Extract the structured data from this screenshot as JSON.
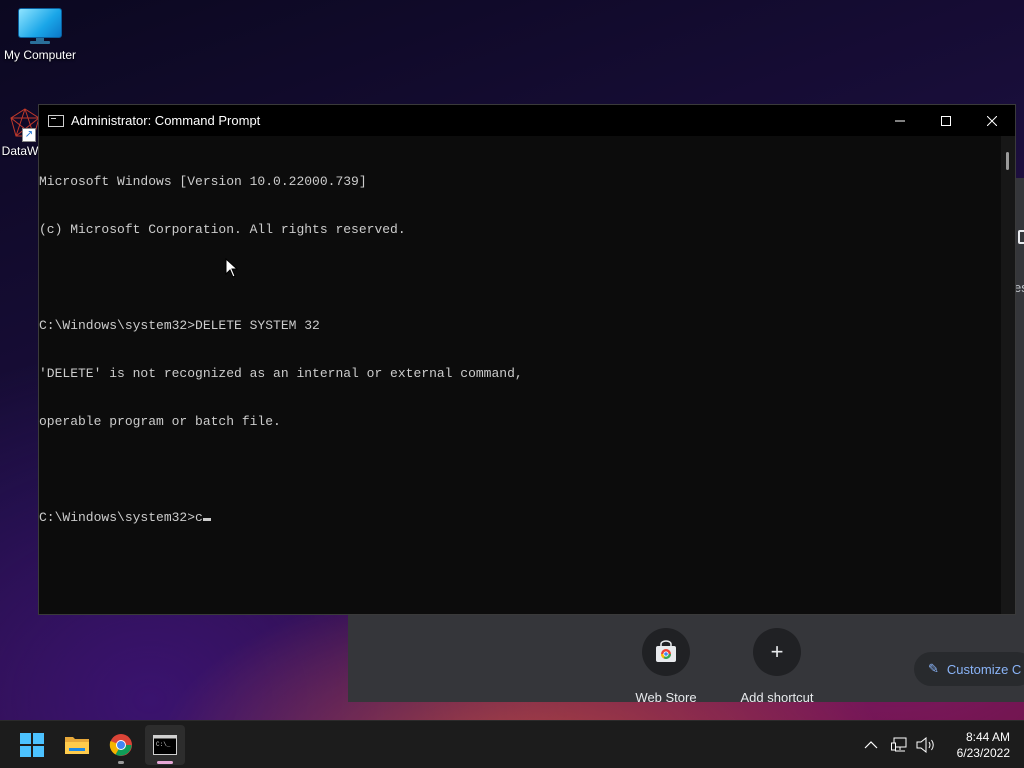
{
  "desktop": {
    "icons": [
      {
        "label": "My Computer"
      },
      {
        "label": "DataW"
      }
    ]
  },
  "chrome_background": {
    "tiles": [
      {
        "label": "Web Store",
        "icon": "webstore-icon"
      },
      {
        "label": "Add shortcut",
        "icon": "plus-icon"
      }
    ],
    "customize_label": "Customize C",
    "right_edge_fragment": "es"
  },
  "cmd_window": {
    "title": "Administrator: Command Prompt",
    "lines": [
      "Microsoft Windows [Version 10.0.22000.739]",
      "(c) Microsoft Corporation. All rights reserved.",
      "",
      "C:\\Windows\\system32>DELETE SYSTEM 32",
      "'DELETE' is not recognized as an internal or external command,",
      "operable program or batch file.",
      ""
    ],
    "prompt": "C:\\Windows\\system32>",
    "input_value": "c"
  },
  "taskbar": {
    "apps": [
      {
        "name": "Start",
        "icon": "windows-start-icon"
      },
      {
        "name": "File Explorer",
        "icon": "folder-icon"
      },
      {
        "name": "Google Chrome",
        "icon": "chrome-icon"
      },
      {
        "name": "Command Prompt",
        "icon": "cmd-icon"
      }
    ],
    "tray": {
      "time": "8:44 AM",
      "date": "6/23/2022"
    }
  },
  "colors": {
    "console_bg": "#0c0c0c",
    "console_text": "#cccccc",
    "taskbar_bg": "#1c1c1c",
    "chrome_link": "#8ab4f8"
  }
}
